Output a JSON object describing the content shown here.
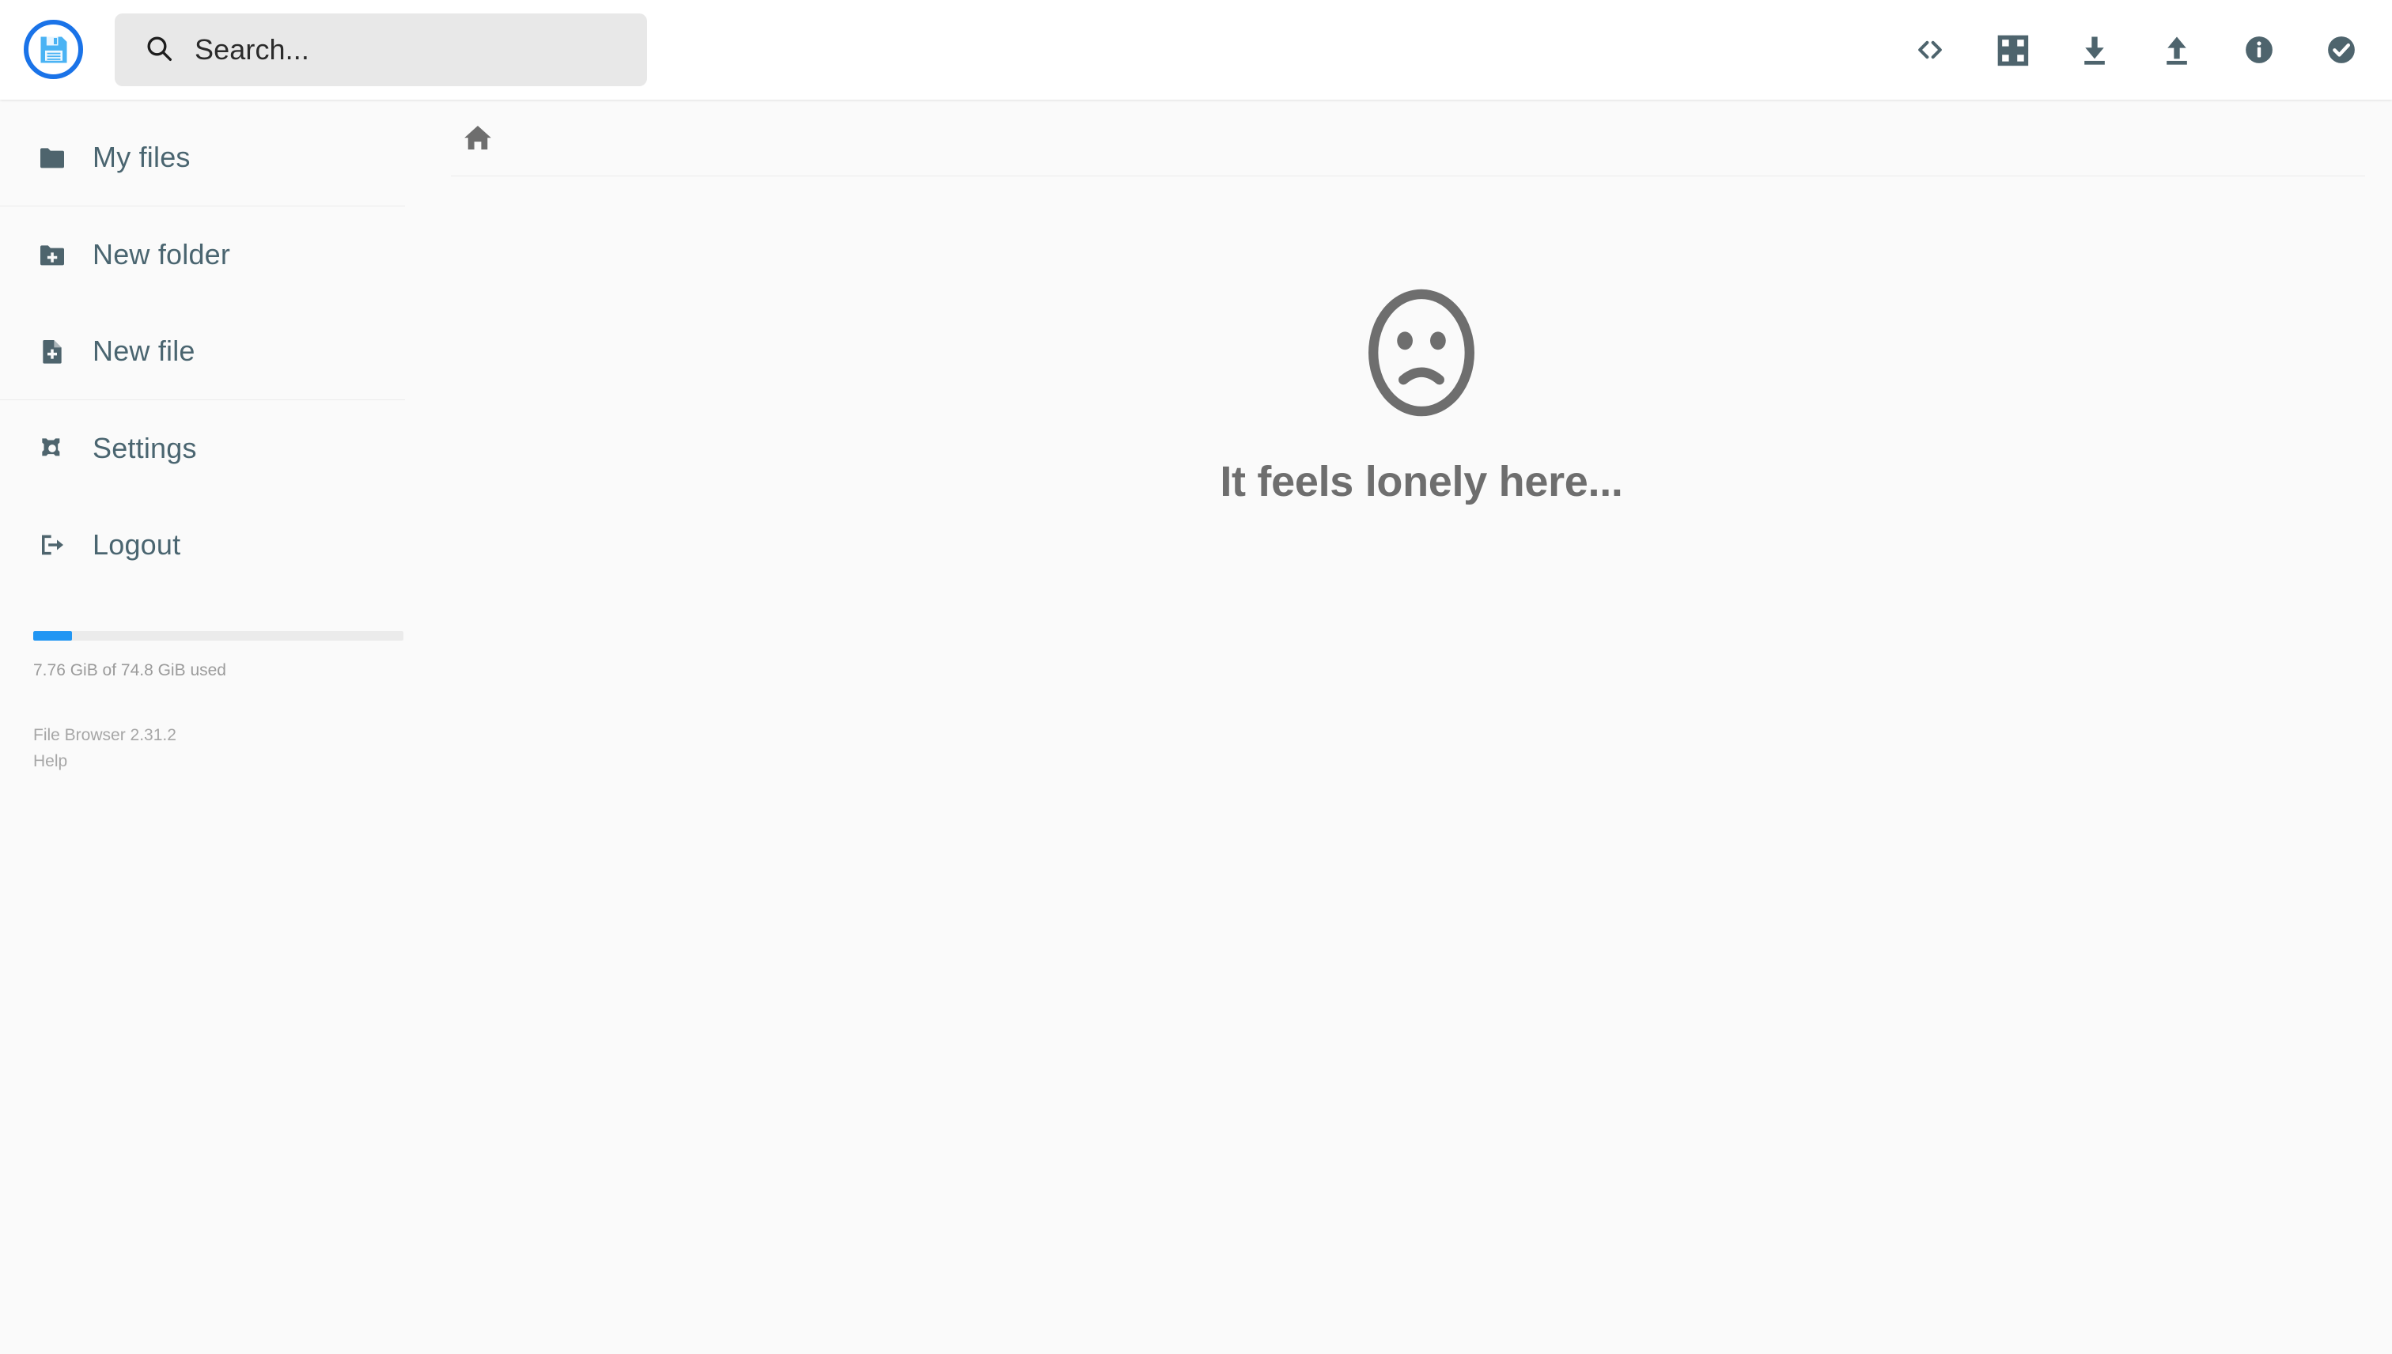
{
  "app": {
    "name": "File Browser",
    "logo_icon": "floppy-disk-icon"
  },
  "header": {
    "search": {
      "placeholder": "Search...",
      "value": "",
      "icon": "search-icon"
    },
    "actions": [
      {
        "name": "code-icon",
        "label": "Switch view (code)"
      },
      {
        "name": "grid-view-icon",
        "label": "Switch view"
      },
      {
        "name": "download-icon",
        "label": "Download"
      },
      {
        "name": "upload-icon",
        "label": "Upload"
      },
      {
        "name": "info-circle-icon",
        "label": "Info"
      },
      {
        "name": "check-circle-icon",
        "label": "Select multiple"
      }
    ]
  },
  "sidebar": {
    "items": [
      {
        "label": "My files",
        "icon": "folder-icon"
      },
      {
        "label": "New folder",
        "icon": "folder-plus-icon"
      },
      {
        "label": "New file",
        "icon": "file-plus-icon"
      },
      {
        "label": "Settings",
        "icon": "gear-icon"
      },
      {
        "label": "Logout",
        "icon": "logout-icon"
      }
    ],
    "storage": {
      "text": "7.76 GiB of 74.8 GiB used",
      "used_gib": 7.76,
      "total_gib": 74.8,
      "percent": 10.4,
      "fill_color": "#2196f3",
      "track_color": "#ebebeb"
    },
    "credits": {
      "version": "File Browser 2.31.2",
      "help_label": "Help"
    }
  },
  "main": {
    "breadcrumb": {
      "home_icon": "home-icon",
      "path": "/"
    },
    "empty_state": {
      "icon": "sad-face-icon",
      "message": "It feels lonely here..."
    }
  },
  "colors": {
    "accent": "#2196f3",
    "logo_ring": "#1a73e8",
    "sidebar_text": "#4a6570",
    "icon": "#546e7a",
    "muted_text": "#a6a6a6",
    "empty_text": "#6e6e6e",
    "background": "#fafafa",
    "header_bg": "#ffffff",
    "search_bg": "#e8e8e8"
  }
}
